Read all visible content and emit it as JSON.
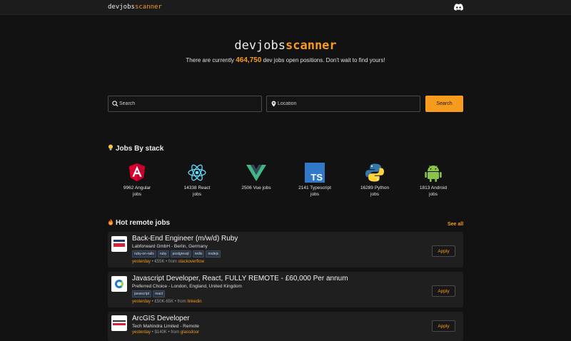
{
  "brand": {
    "prefix": "devjobs",
    "suffix": "scanner"
  },
  "header": {
    "discord_icon": "discord-icon"
  },
  "hero": {
    "title_prefix": "devjobs",
    "title_suffix": "scanner",
    "subtitle_before": "There are currently ",
    "count": "464,750",
    "subtitle_after": " dev jobs open positions. Don't wait to find yours!"
  },
  "search": {
    "query_placeholder": "Search",
    "location_placeholder": "Location",
    "button_label": "Search"
  },
  "stacks_section": {
    "title": "Jobs By stack",
    "items": [
      {
        "line1": "9962 Angular",
        "line2": "jobs",
        "icon": "angular-logo"
      },
      {
        "line1": "14338 React",
        "line2": "jobs",
        "icon": "react-logo"
      },
      {
        "line1": "2506 Vue jobs",
        "line2": "",
        "icon": "vue-logo"
      },
      {
        "line1": "2141 Typescript",
        "line2": "jobs",
        "icon": "typescript-logo"
      },
      {
        "line1": "16289 Python",
        "line2": "jobs",
        "icon": "python-logo"
      },
      {
        "line1": "1813 Android",
        "line2": "jobs",
        "icon": "android-logo"
      }
    ]
  },
  "remote_section": {
    "title": "Hot remote jobs",
    "see_all": "See all",
    "jobs": [
      {
        "title": "Back-End Engineer (m/w/d) Ruby",
        "company": "Labforward GmbH - Berlin, Germany",
        "tags": [
          "ruby-on-rails",
          "ruby",
          "postgresql",
          "redis",
          "nodejs"
        ],
        "when": "yesterday",
        "salary": " • €55K • from ",
        "source": "stackoverflow",
        "apply": "Apply"
      },
      {
        "title": "Javascript Developer, React, FULLY REMOTE - £60,000 Per annum",
        "company": "Preferred Choice - London, England, United Kingdom",
        "tags": [
          "javascript",
          "react"
        ],
        "when": "yesterday",
        "salary": " • £50K-65K • from ",
        "source": "linkedin",
        "apply": "Apply"
      },
      {
        "title": "ArcGIS Developer",
        "company": "Tech Mahindra Limited - Remote",
        "tags": [],
        "when": "yesterday",
        "salary": " • $140K • from ",
        "source": "glassdoor",
        "apply": "Apply"
      }
    ]
  },
  "colors": {
    "accent": "#f79b1c",
    "background": "#121212",
    "card": "#1f1f1f"
  }
}
